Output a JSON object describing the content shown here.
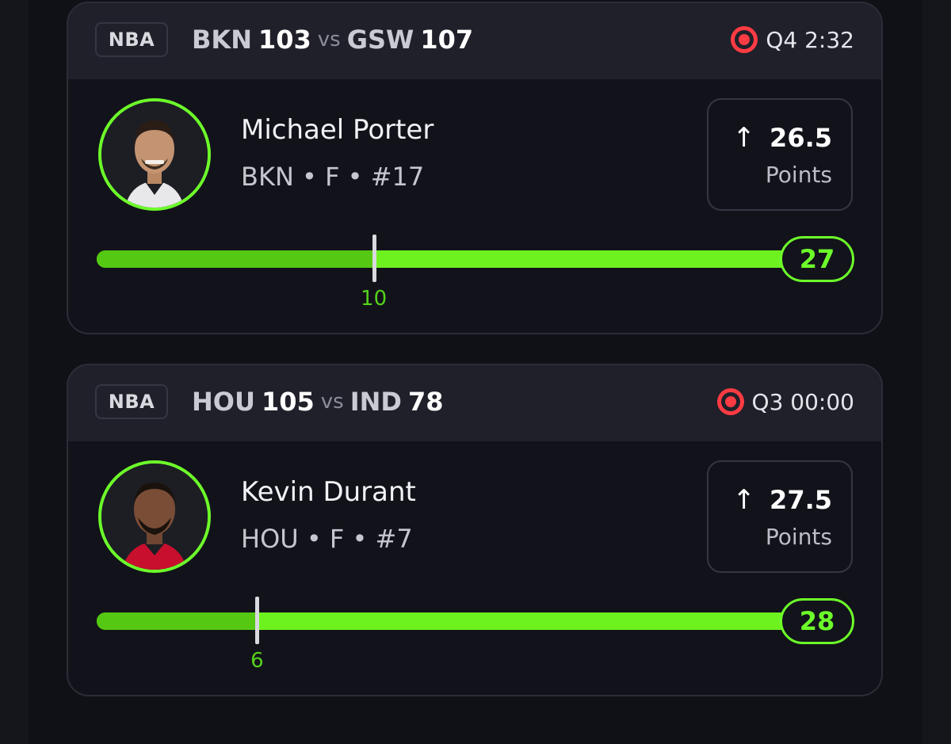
{
  "cards": [
    {
      "league": "NBA",
      "home_team": "BKN",
      "home_score": "103",
      "vs": "vs",
      "away_team": "GSW",
      "away_score": "107",
      "game_clock": "Q4 2:32",
      "player_name": "Michael Porter",
      "player_meta": "BKN • F • #17",
      "line_value": "26.5",
      "line_stat": "Points",
      "direction_icon": "arrow-up-icon",
      "marker_value": "10",
      "current_total": "27",
      "progress_fraction": 0.38
    },
    {
      "league": "NBA",
      "home_team": "HOU",
      "home_score": "105",
      "vs": "vs",
      "away_team": "IND",
      "away_score": "78",
      "game_clock": "Q3 00:00",
      "player_name": "Kevin Durant",
      "player_meta": "HOU • F • #7",
      "line_value": "27.5",
      "line_stat": "Points",
      "direction_icon": "arrow-up-icon",
      "marker_value": "6",
      "current_total": "28",
      "progress_fraction": 0.22
    }
  ],
  "colors": {
    "accent": "#6dff2a",
    "live": "#ff3b43",
    "jersey_bkn": "#e8e8ea",
    "jersey_hou": "#c8102e"
  }
}
